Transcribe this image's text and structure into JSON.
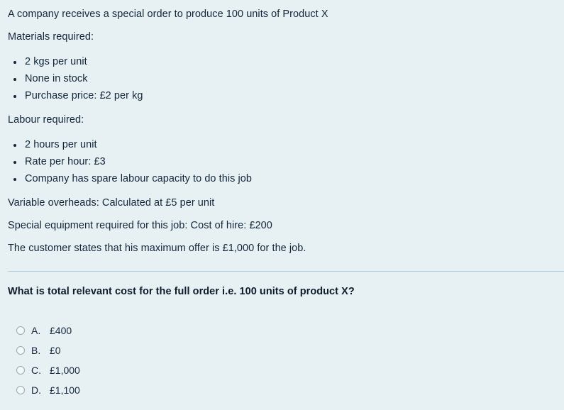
{
  "stem": {
    "intro": "A company receives a special order to produce 100 units of Product X",
    "materials_heading": "Materials required:",
    "materials_items": [
      "2 kgs per unit",
      "None in stock",
      "Purchase price: £2 per kg"
    ],
    "labour_heading": "Labour required:",
    "labour_items": [
      "2 hours per unit",
      "Rate per hour: £3",
      "Company has spare labour capacity to do this job"
    ],
    "variable_overheads": "Variable overheads: Calculated at £5 per unit",
    "special_equipment": "Special equipment required for this job: Cost of hire: £200",
    "customer_offer": "The customer states that his maximum offer is £1,000 for the job."
  },
  "question": {
    "text": "What is total relevant cost for the full order i.e. 100 units of product X?"
  },
  "options": [
    {
      "letter": "A.",
      "value": "£400",
      "selected": false
    },
    {
      "letter": "B.",
      "value": "£0",
      "selected": false
    },
    {
      "letter": "C.",
      "value": "£1,000",
      "selected": false
    },
    {
      "letter": "D.",
      "value": "£1,100",
      "selected": false
    }
  ],
  "colors": {
    "background": "#e7f1f4",
    "text": "#12263a",
    "divider": "#a9d1dd",
    "radio_border": "#9aa7ad"
  }
}
